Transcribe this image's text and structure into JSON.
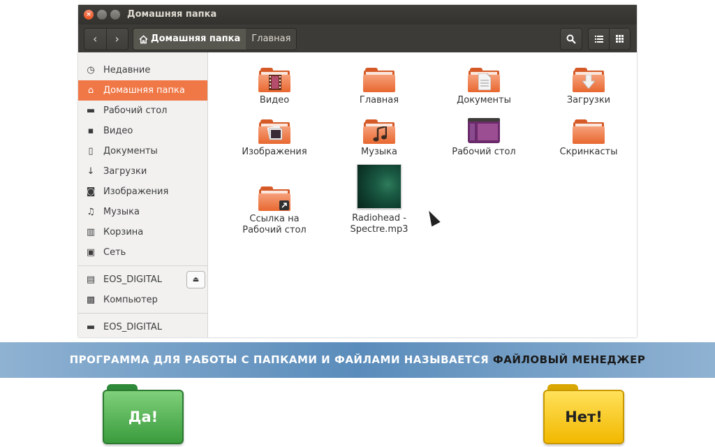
{
  "window": {
    "title": "Домашняя папка",
    "controls": {
      "close": "×",
      "minimize": "–",
      "maximize": "□"
    }
  },
  "toolbar": {
    "back_glyph": "‹",
    "forward_glyph": "›",
    "breadcrumbs": [
      "Домашняя папка",
      "Главная"
    ],
    "search_icon": "search-icon",
    "list_view_icon": "list-view-icon",
    "grid_view_icon": "grid-view-icon"
  },
  "sidebar": {
    "items": [
      {
        "label": "Недавние",
        "icon": "recent-icon"
      },
      {
        "label": "Домашняя папка",
        "icon": "home-icon",
        "active": true
      },
      {
        "label": "Рабочий стол",
        "icon": "desktop-icon"
      },
      {
        "label": "Видео",
        "icon": "video-icon"
      },
      {
        "label": "Документы",
        "icon": "document-icon"
      },
      {
        "label": "Загрузки",
        "icon": "download-icon"
      },
      {
        "label": "Изображения",
        "icon": "camera-icon"
      },
      {
        "label": "Музыка",
        "icon": "music-icon"
      },
      {
        "label": "Корзина",
        "icon": "trash-icon"
      },
      {
        "label": "Сеть",
        "icon": "network-icon"
      }
    ],
    "devices": [
      {
        "label": "EOS_DIGITAL",
        "icon": "sdcard-icon",
        "eject": true
      },
      {
        "label": "Компьютер",
        "icon": "computer-icon"
      }
    ],
    "network": [
      {
        "label": "EOS_DIGITAL",
        "icon": "folder-icon"
      }
    ]
  },
  "files": [
    {
      "name": "Видео",
      "icon": "folder-video-icon"
    },
    {
      "name": "Главная",
      "icon": "folder-icon"
    },
    {
      "name": "Документы",
      "icon": "folder-documents-icon"
    },
    {
      "name": "Загрузки",
      "icon": "folder-download-icon"
    },
    {
      "name": "Изображения",
      "icon": "folder-pictures-icon"
    },
    {
      "name": "Музыка",
      "icon": "folder-music-icon"
    },
    {
      "name": "Рабочий стол",
      "icon": "desktop-folder-icon"
    },
    {
      "name": "Скринкасты",
      "icon": "folder-icon"
    },
    {
      "name": "Ссылка на Рабочий стол",
      "icon": "folder-link-icon"
    },
    {
      "name": "Radiohead - Spectre.mp3",
      "icon": "audio-thumbnail"
    }
  ],
  "banner": {
    "text": "ПРОГРАММА ДЛЯ РАБОТЫ С ПАПКАМИ И ФАЙЛАМИ НАЗЫВАЕТСЯ",
    "highlight": "ФАЙЛОВЫЙ МЕНЕДЖЕР"
  },
  "answers": {
    "yes": "Да!",
    "no": "Нет!"
  },
  "colors": {
    "accent": "#f07746",
    "folder": "#e8672f",
    "banner": "#5a8cbb",
    "yes": "#3a9c3d",
    "no": "#f2b800"
  }
}
